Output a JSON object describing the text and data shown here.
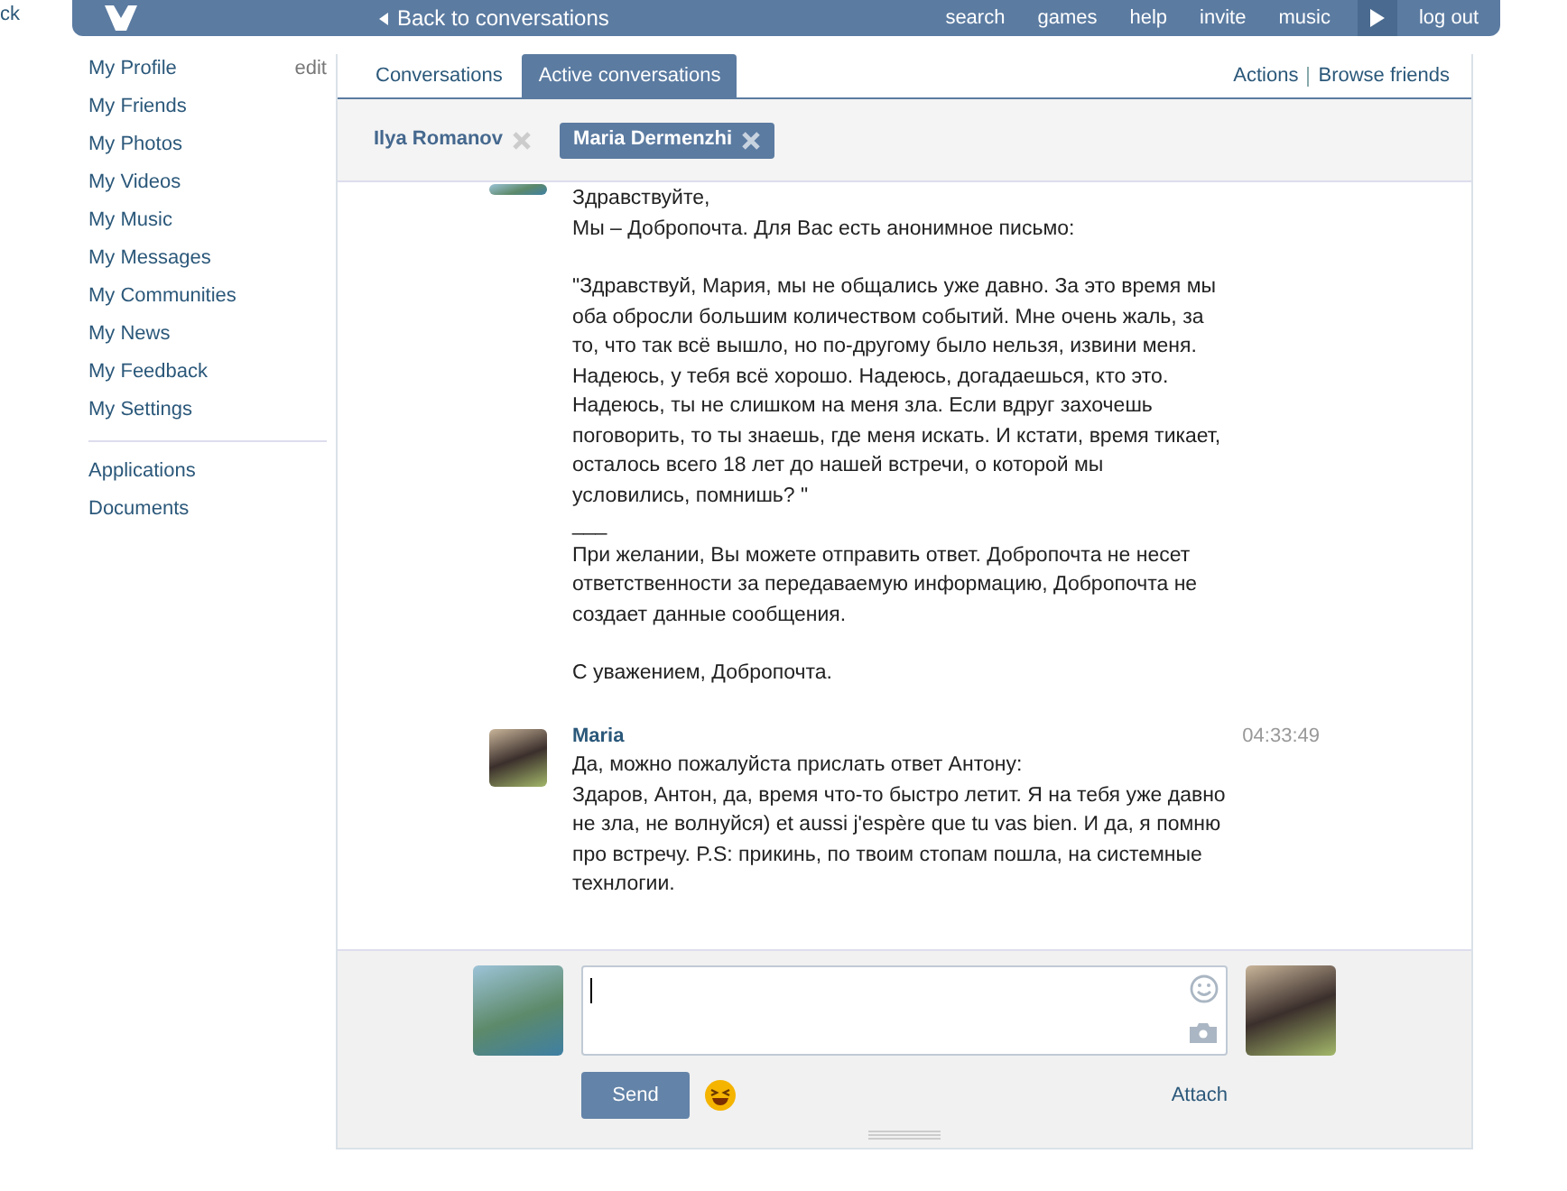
{
  "corner_text": "ck",
  "header": {
    "back_link": "Back to conversations",
    "links": [
      "search",
      "games",
      "help",
      "invite",
      "music"
    ],
    "logout": "log out"
  },
  "sidebar": {
    "edit": "edit",
    "items": [
      {
        "label": "My Profile"
      },
      {
        "label": "My Friends"
      },
      {
        "label": "My Photos"
      },
      {
        "label": "My Videos"
      },
      {
        "label": "My Music"
      },
      {
        "label": "My Messages"
      },
      {
        "label": "My Communities"
      },
      {
        "label": "My News"
      },
      {
        "label": "My Feedback"
      },
      {
        "label": "My Settings"
      }
    ],
    "extra_items": [
      {
        "label": "Applications"
      },
      {
        "label": "Documents"
      }
    ]
  },
  "tabs": [
    {
      "label": "Conversations",
      "selected": false
    },
    {
      "label": "Active conversations",
      "selected": true
    }
  ],
  "actions": [
    "Actions",
    "Browse friends"
  ],
  "chips": [
    {
      "label": "Ilya Romanov",
      "selected": false
    },
    {
      "label": "Maria Dermenzhi",
      "selected": true
    }
  ],
  "messages": [
    {
      "kind": "continued",
      "paragraphs": [
        "Здравствуйте,\nМы – Добропочта. Для Вас есть анонимное письмо:",
        "\"Здравствуй, Мария, мы не общались уже давно. За это время мы оба обросли большим количеством событий. Мне очень жаль, за то, что так всё вышло, но по-другому было нельзя, извини меня. Надеюсь, у тебя всё хорошо. Надеюсь, догадаешься, кто это. Надеюсь, ты не слишком на меня зла. Если вдруг захочешь поговорить, то ты знаешь, где меня искать. И кстати, время тикает, осталось всего 18 лет до нашей встречи, о которой мы условились, помнишь? \"\n___\nПри желании, Вы можете отправить ответ. Добропочта не несет ответственности за передаваемую информацию, Добропочта не создает данные сообщения.",
        "С уважением, Добропочта."
      ]
    },
    {
      "kind": "full",
      "sender": "Maria",
      "time": "04:33:49",
      "paragraphs": [
        "Да, можно пожалуйста прислать ответ Антону:\nЗдаров, Антон, да, время что-то быстро летит. Я на тебя уже давно не зла, не волнуйся) et aussi j'espère que tu vas bien. И да, я помню про встречу. P.S: прикинь, по твоим стопам пошла, на системные технлогии."
      ]
    }
  ],
  "composer": {
    "send": "Send",
    "attach": "Attach"
  }
}
